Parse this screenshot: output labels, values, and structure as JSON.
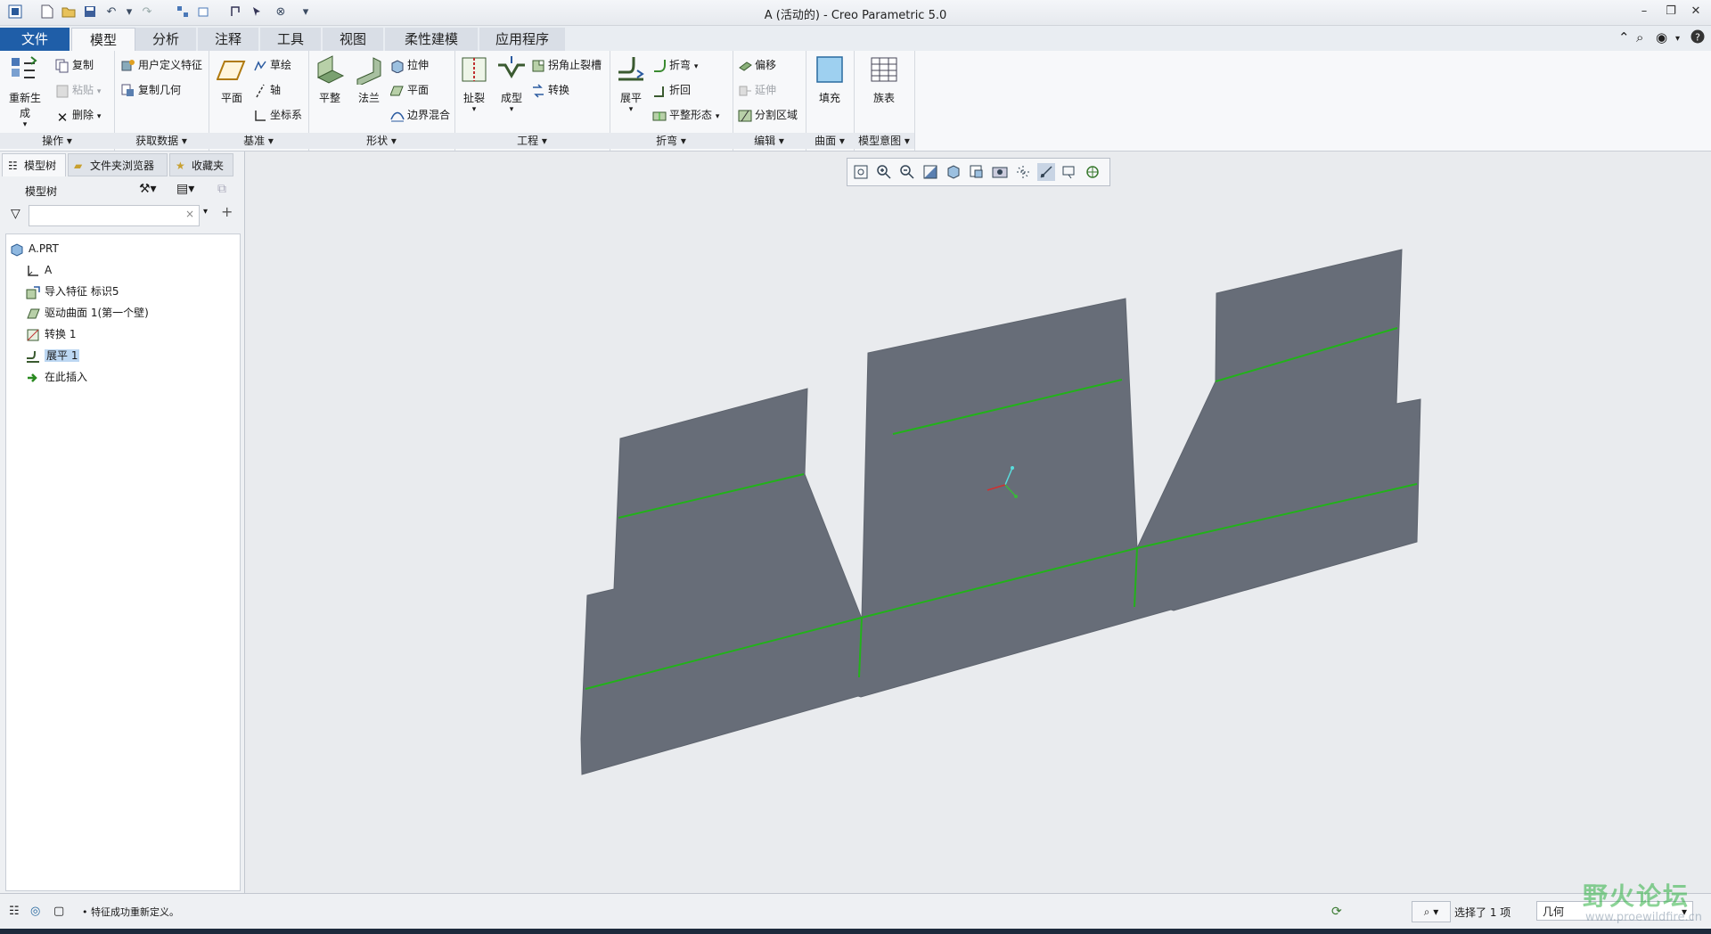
{
  "window": {
    "title": "A (活动的) - Creo Parametric 5.0",
    "controls": [
      "minimize-icon",
      "restore-icon",
      "close-icon"
    ]
  },
  "tabs": [
    {
      "label": "文件"
    },
    {
      "label": "模型"
    },
    {
      "label": "分析"
    },
    {
      "label": "注释"
    },
    {
      "label": "工具"
    },
    {
      "label": "视图"
    },
    {
      "label": "柔性建模"
    },
    {
      "label": "应用程序"
    }
  ],
  "ribbon": {
    "ops": {
      "label": "操作",
      "regen": "重新生成",
      "copy": "复制",
      "paste": "粘贴",
      "delete": "删除"
    },
    "getdata": {
      "label": "获取数据",
      "udf": "用户定义特征",
      "copygeom": "复制几何"
    },
    "datum": {
      "label": "基准",
      "plane": "平面",
      "sketch": "草绘",
      "axis": "轴",
      "csys": "坐标系"
    },
    "shapes": {
      "label": "形状",
      "flat": "平整",
      "flange": "法兰",
      "extrude": "拉伸",
      "plane": "平面",
      "blend": "边界混合"
    },
    "engineering": {
      "label": "工程",
      "rip": "扯裂",
      "form": "成型",
      "relief": "拐角止裂槽",
      "convert": "转换"
    },
    "bends": {
      "label": "折弯",
      "unbend": "展平",
      "bend": "折弯",
      "bendback": "折回",
      "flatpattern": "平整形态"
    },
    "editing": {
      "label": "编辑",
      "offset": "偏移",
      "extend": "延伸",
      "split": "分割区域"
    },
    "surfaces": {
      "label": "曲面",
      "fill": "填充"
    },
    "intent": {
      "label": "模型意图",
      "family": "族表"
    }
  },
  "panel": {
    "tabs": [
      "模型树",
      "文件夹浏览器",
      "收藏夹"
    ],
    "header": "模型树",
    "search_value": "",
    "tree": [
      {
        "label": "A.PRT",
        "icon": "part-icon"
      },
      {
        "label": "A",
        "icon": "csys-icon"
      },
      {
        "label": "导入特征 标识5",
        "icon": "import-feature-icon"
      },
      {
        "label": "驱动曲面 1(第一个壁)",
        "icon": "driving-surface-icon"
      },
      {
        "label": "转换 1",
        "icon": "convert-icon"
      },
      {
        "label": "展平 1",
        "icon": "unbend-icon"
      },
      {
        "label": "在此插入",
        "icon": "insert-here-icon"
      }
    ]
  },
  "status": {
    "message": "特征成功重新定义。",
    "selection": "选择了 1 项",
    "filter": "几何"
  },
  "watermark": {
    "text": "野火论坛",
    "url": "www.proewildfire.cn"
  },
  "colors": {
    "accent": "#1f5ea8",
    "surface": "#676d78",
    "bendline": "#22b21a"
  }
}
